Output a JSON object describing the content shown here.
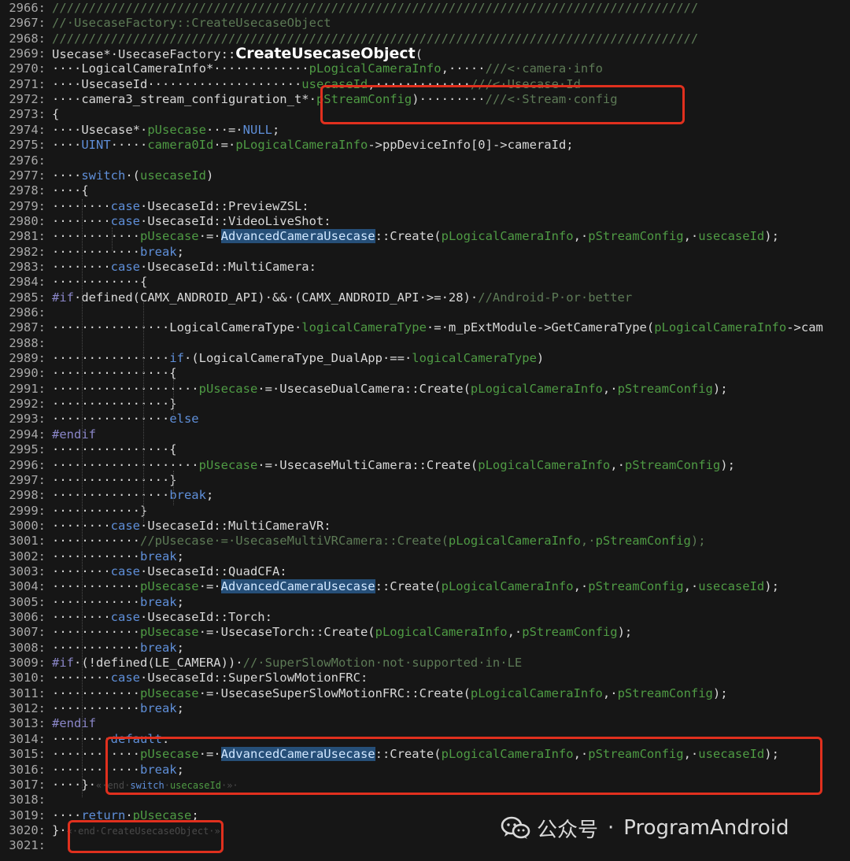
{
  "watermark": {
    "icon": "wechat-icon",
    "account": "公众号",
    "separator": "·",
    "name": "ProgramAndroid"
  },
  "colors": {
    "background": "#161616",
    "highlight_box": "#e0301e",
    "selection": "#264f78",
    "comment": "#5d7a56",
    "keyword": "#5f8fd9"
  },
  "lines": [
    {
      "n": "2966:",
      "t": "////////////////////////////////////////////////////////////////////////////////////////"
    },
    {
      "n": "2967:",
      "t": "//·UsecaseFactory::CreateUsecaseObject"
    },
    {
      "n": "2968:",
      "t": "////////////////////////////////////////////////////////////////////////////////////////"
    },
    {
      "n": "2969:",
      "t": "Usecase*·UsecaseFactory::CreateUsecaseObject("
    },
    {
      "n": "2970:",
      "t": "····LogicalCameraInfo*·············pLogicalCameraInfo,·····///<·camera·info"
    },
    {
      "n": "2971:",
      "t": "····UsecaseId·····················usecaseId,·············///<·Usecase·Id"
    },
    {
      "n": "2972:",
      "t": "····camera3_stream_configuration_t*·pStreamConfig)·········///<·Stream·config"
    },
    {
      "n": "2973:",
      "t": "{"
    },
    {
      "n": "2974:",
      "t": "····Usecase*·pUsecase···=·NULL;"
    },
    {
      "n": "2975:",
      "t": "····UINT·····camera0Id·=·pLogicalCameraInfo->ppDeviceInfo[0]->cameraId;"
    },
    {
      "n": "2976:",
      "t": ""
    },
    {
      "n": "2977:",
      "t": "····switch·(usecaseId)"
    },
    {
      "n": "2978:",
      "t": "····{"
    },
    {
      "n": "2979:",
      "t": "········case·UsecaseId::PreviewZSL:"
    },
    {
      "n": "2980:",
      "t": "········case·UsecaseId::VideoLiveShot:"
    },
    {
      "n": "2981:",
      "t": "············pUsecase·=·AdvancedCameraUsecase::Create(pLogicalCameraInfo,·pStreamConfig,·usecaseId);"
    },
    {
      "n": "2982:",
      "t": "············break;"
    },
    {
      "n": "2983:",
      "t": "········case·UsecaseId::MultiCamera:"
    },
    {
      "n": "2984:",
      "t": "············{"
    },
    {
      "n": "2985:",
      "t": "#if·defined(CAMX_ANDROID_API)·&&·(CAMX_ANDROID_API·>=·28)·//Android-P·or·better"
    },
    {
      "n": "2986:",
      "t": ""
    },
    {
      "n": "2987:",
      "t": "················LogicalCameraType·logicalCameraType·=·m_pExtModule->GetCameraType(pLogicalCameraInfo->cam"
    },
    {
      "n": "2988:",
      "t": ""
    },
    {
      "n": "2989:",
      "t": "················if·(LogicalCameraType_DualApp·==·logicalCameraType)"
    },
    {
      "n": "2990:",
      "t": "················{"
    },
    {
      "n": "2991:",
      "t": "····················pUsecase·=·UsecaseDualCamera::Create(pLogicalCameraInfo,·pStreamConfig);"
    },
    {
      "n": "2992:",
      "t": "················}"
    },
    {
      "n": "2993:",
      "t": "················else"
    },
    {
      "n": "2994:",
      "t": "#endif"
    },
    {
      "n": "2995:",
      "t": "················{"
    },
    {
      "n": "2996:",
      "t": "····················pUsecase·=·UsecaseMultiCamera::Create(pLogicalCameraInfo,·pStreamConfig);"
    },
    {
      "n": "2997:",
      "t": "················}"
    },
    {
      "n": "2998:",
      "t": "················break;"
    },
    {
      "n": "2999:",
      "t": "············}"
    },
    {
      "n": "3000:",
      "t": "········case·UsecaseId::MultiCameraVR:"
    },
    {
      "n": "3001:",
      "t": "············//pUsecase·=·UsecaseMultiVRCamera::Create(pLogicalCameraInfo,·pStreamConfig);"
    },
    {
      "n": "3002:",
      "t": "············break;"
    },
    {
      "n": "3003:",
      "t": "········case·UsecaseId::QuadCFA:"
    },
    {
      "n": "3004:",
      "t": "············pUsecase·=·AdvancedCameraUsecase::Create(pLogicalCameraInfo,·pStreamConfig,·usecaseId);"
    },
    {
      "n": "3005:",
      "t": "············break;"
    },
    {
      "n": "3006:",
      "t": "········case·UsecaseId::Torch:"
    },
    {
      "n": "3007:",
      "t": "············pUsecase·=·UsecaseTorch::Create(pLogicalCameraInfo,·pStreamConfig);"
    },
    {
      "n": "3008:",
      "t": "············break;"
    },
    {
      "n": "3009:",
      "t": "#if·(!defined(LE_CAMERA))·//·SuperSlowMotion·not·supported·in·LE"
    },
    {
      "n": "3010:",
      "t": "········case·UsecaseId::SuperSlowMotionFRC:"
    },
    {
      "n": "3011:",
      "t": "············pUsecase·=·UsecaseSuperSlowMotionFRC::Create(pLogicalCameraInfo,·pStreamConfig);"
    },
    {
      "n": "3012:",
      "t": "············break;"
    },
    {
      "n": "3013:",
      "t": "#endif"
    },
    {
      "n": "3014:",
      "t": "········default:"
    },
    {
      "n": "3015:",
      "t": "············pUsecase·=·AdvancedCameraUsecase::Create(pLogicalCameraInfo,·pStreamConfig,·usecaseId);"
    },
    {
      "n": "3016:",
      "t": "············break;"
    },
    {
      "n": "3017:",
      "t": "····}·«·end·switch·usecaseId·»·"
    },
    {
      "n": "3018:",
      "t": ""
    },
    {
      "n": "3019:",
      "t": "····return·pUsecase;"
    },
    {
      "n": "3020:",
      "t": "}·«·end·CreateUsecaseObject·»·"
    },
    {
      "n": "3021:",
      "t": ""
    }
  ]
}
